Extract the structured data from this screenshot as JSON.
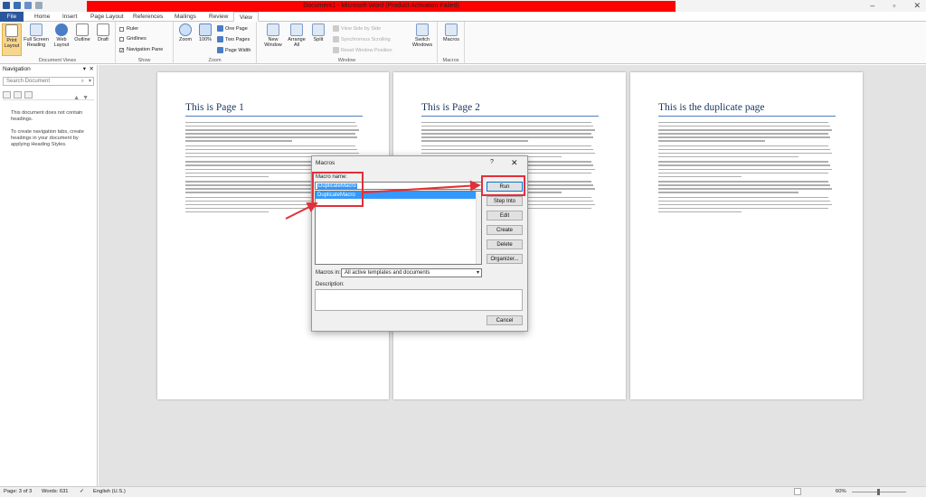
{
  "window": {
    "title": "Document1 - Microsoft Word (Product Activation Failed)"
  },
  "tabs": [
    "File",
    "Home",
    "Insert",
    "Page Layout",
    "References",
    "Mailings",
    "Review",
    "View"
  ],
  "ribbon": {
    "document_views": {
      "label": "Document Views",
      "buttons": [
        "Print Layout",
        "Full Screen Reading",
        "Web Layout",
        "Outline",
        "Draft"
      ]
    },
    "show": {
      "label": "Show",
      "ruler": "Ruler",
      "gridlines": "Gridlines",
      "navigation_pane": "Navigation Pane"
    },
    "zoom": {
      "label": "Zoom",
      "zoom": "Zoom",
      "percent": "100%",
      "one_page": "One Page",
      "two_pages": "Two Pages",
      "page_width": "Page Width"
    },
    "window": {
      "label": "Window",
      "new_window": "New Window",
      "arrange_all": "Arrange All",
      "split": "Split",
      "view_side_by_side": "View Side by Side",
      "synchronous_scrolling": "Synchronous Scrolling",
      "reset_window_position": "Reset Window Position",
      "switch_windows": "Switch Windows"
    },
    "macros": {
      "label": "Macros",
      "button": "Macros"
    }
  },
  "navigation": {
    "title": "Navigation",
    "search_placeholder": "Search Document",
    "message1": "This document does not contain headings.",
    "message2": "To create navigation tabs, create headings in your document by applying Heading Styles."
  },
  "pages": [
    {
      "heading": "This is Page 1"
    },
    {
      "heading": "This is Page 2"
    },
    {
      "heading": "This is the duplicate page"
    }
  ],
  "dialog": {
    "title": "Macros",
    "help": "?",
    "close": "✕",
    "macro_name_label": "Macro name:",
    "macro_name_value": "DuplicateMacro",
    "list_items": [
      "DuplicateMacro"
    ],
    "buttons": {
      "run": "Run",
      "step_into": "Step Into",
      "edit": "Edit",
      "create": "Create",
      "delete": "Delete",
      "organizer": "Organizer...",
      "cancel": "Cancel"
    },
    "macros_in_label": "Macros in:",
    "macros_in_value": "All active templates and documents",
    "description_label": "Description:"
  },
  "status": {
    "page": "Page: 3 of 3",
    "words": "Words: 631",
    "language": "English (U.S.)",
    "zoom": "60%"
  },
  "colors": {
    "title_bar": "#ff0000",
    "file_tab": "#2b579a",
    "highlight": "#e0303a",
    "selection": "#3399ff",
    "heading": "#17365d"
  }
}
